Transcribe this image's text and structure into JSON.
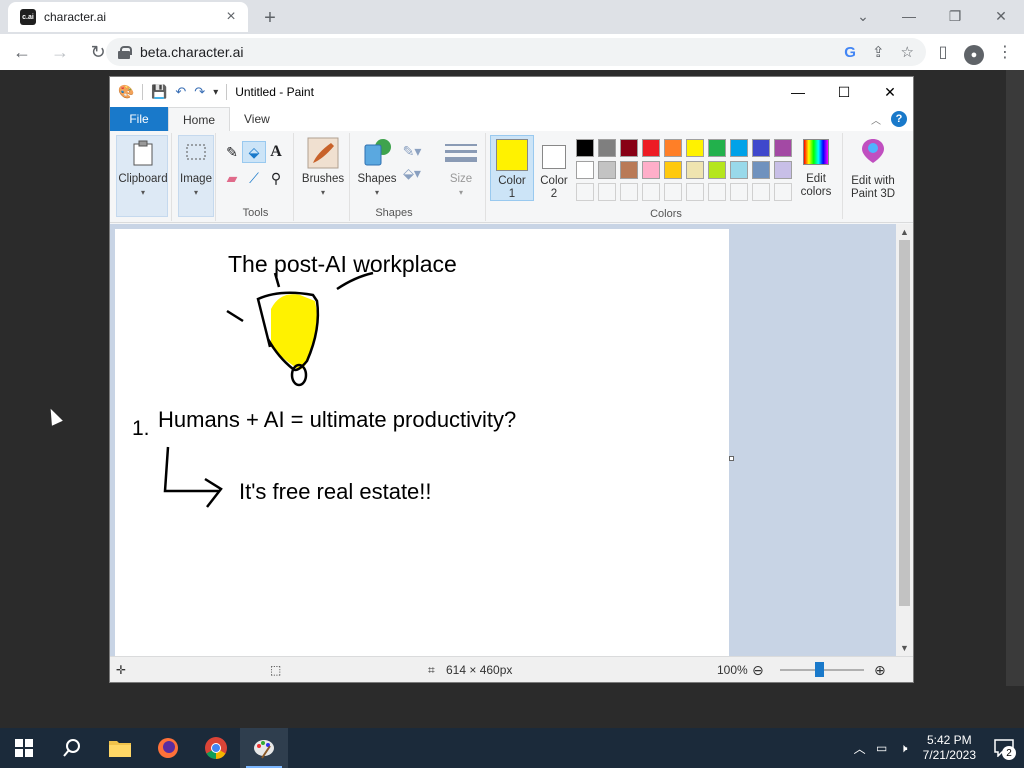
{
  "browser": {
    "tab_favicon": "c.ai",
    "tab_title": "character.ai",
    "url": "beta.character.ai"
  },
  "paint": {
    "window_title": "Untitled - Paint",
    "ribbon_tabs": [
      "File",
      "Home",
      "View"
    ],
    "groups": {
      "clipboard": "Clipboard",
      "image": "Image",
      "tools": "Tools",
      "brushes": "Brushes",
      "shapes": "Shapes",
      "size": "Size",
      "color1": "Color",
      "color1_num": "1",
      "color2": "Color",
      "color2_num": "2",
      "colors": "Colors",
      "edit_colors_1": "Edit",
      "edit_colors_2": "colors",
      "paint3d_1": "Edit with",
      "paint3d_2": "Paint 3D"
    },
    "palette_row1": [
      "#000000",
      "#7f7f7f",
      "#880015",
      "#ed1c24",
      "#ff7f27",
      "#fff200",
      "#22b14c",
      "#00a2e8",
      "#3f48cc",
      "#a349a4"
    ],
    "palette_row2": [
      "#ffffff",
      "#c3c3c3",
      "#b97a57",
      "#ffaec9",
      "#ffc90e",
      "#efe4b0",
      "#b5e61d",
      "#99d9ea",
      "#7092be",
      "#c8bfe7"
    ],
    "color1_value": "#fff200",
    "color2_value": "#ffffff",
    "canvas_text": {
      "title": "The post-AI workplace",
      "number": "1.",
      "line1": "Humans + AI = ultimate productivity?",
      "line2": "It's free real estate!!"
    },
    "status": {
      "size": "614 × 460px",
      "zoom": "100%"
    }
  },
  "taskbar": {
    "time": "5:42 PM",
    "date": "7/21/2023",
    "notifications": "2"
  }
}
